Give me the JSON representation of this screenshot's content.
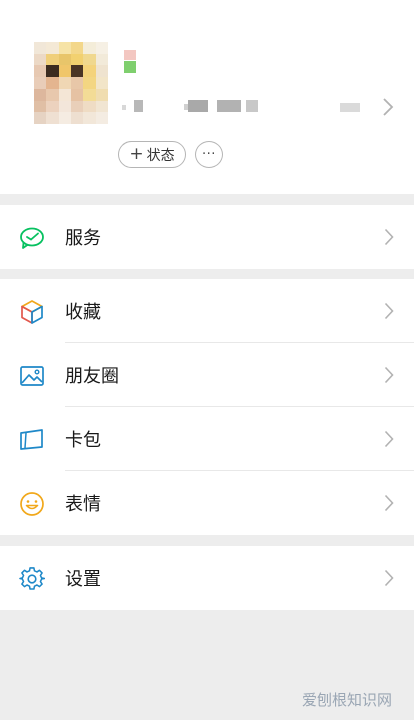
{
  "profile": {
    "status_label": "状态",
    "more_label": "···"
  },
  "menu": {
    "services": "服务",
    "favorites": "收藏",
    "moments": "朋友圈",
    "cards": "卡包",
    "stickers": "表情",
    "settings": "设置"
  },
  "watermark": "爱刨根知识网",
  "colors": {
    "accent_green": "#07c160",
    "background": "#ededed",
    "icon_blue": "#1e88c8",
    "icon_yellow": "#f1a81b"
  }
}
